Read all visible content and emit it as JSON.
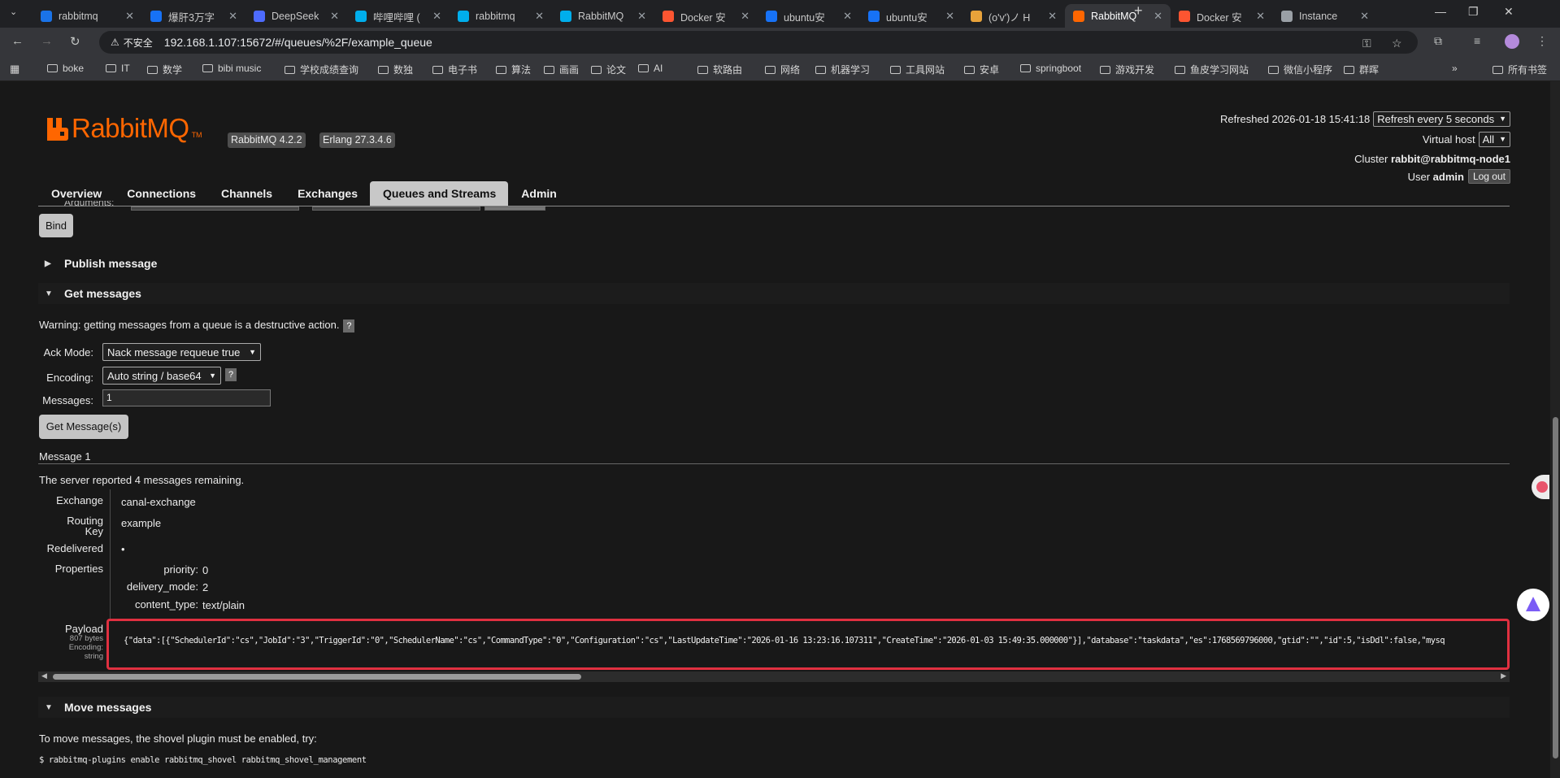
{
  "browser": {
    "tabs": [
      {
        "title": "rabbitmq",
        "icon": "search-icon",
        "color": "#1a73e8"
      },
      {
        "title": "爆肝3万字",
        "icon": "zhihu-icon",
        "color": "#1772f6"
      },
      {
        "title": "DeepSeek",
        "icon": "deepseek-icon",
        "color": "#4d6bfe"
      },
      {
        "title": "哔哩哔哩 (",
        "icon": "bilibili-icon",
        "color": "#00aeec"
      },
      {
        "title": "rabbitmq",
        "icon": "bilibili-icon",
        "color": "#00aeec"
      },
      {
        "title": "RabbitMQ",
        "icon": "bilibili-icon",
        "color": "#00aeec"
      },
      {
        "title": "Docker 安",
        "icon": "csdn-icon",
        "color": "#fc5531"
      },
      {
        "title": "ubuntu安",
        "icon": "zhihu-icon",
        "color": "#1772f6"
      },
      {
        "title": "ubuntu安",
        "icon": "zhihu-icon",
        "color": "#1772f6"
      },
      {
        "title": "(o'v')ノ H",
        "icon": "pinwheel-icon",
        "color": "#e8a23a"
      },
      {
        "title": "RabbitMQ",
        "icon": "rabbitmq-icon",
        "color": "#ff6600"
      },
      {
        "title": "Docker 安",
        "icon": "csdn-icon",
        "color": "#fc5531"
      },
      {
        "title": "Instance",
        "icon": "globe-icon",
        "color": "#9aa0a6"
      }
    ],
    "active_tab_index": 10,
    "security_label": "不安全",
    "url": "192.168.1.107:15672/#/queues/%2F/example_queue",
    "bookmarks": [
      "boke",
      "IT",
      "数学",
      "bibi music",
      "学校成绩查询",
      "数独",
      "电子书",
      "算法",
      "画画",
      "论文",
      "AI",
      "软路由",
      "网络",
      "机器学习",
      "工具网站",
      "安卓",
      "springboot",
      "游戏开发",
      "鱼皮学习网站",
      "微信小程序",
      "群晖"
    ],
    "all_bookmarks": "所有书签"
  },
  "header": {
    "brand": "RabbitMQ",
    "tm": "TM",
    "rabbitmq_version": "RabbitMQ 4.2.2",
    "erlang_version": "Erlang 27.3.4.6",
    "refreshed": "Refreshed 2026-01-18 15:41:18",
    "refresh_option": "Refresh every 5 seconds",
    "virtual_host_label": "Virtual host",
    "virtual_host_value": "All",
    "cluster_label": "Cluster",
    "cluster_value": "rabbit@rabbitmq-node1",
    "user_label": "User",
    "user_value": "admin",
    "logout": "Log out",
    "accent_color": "#ff6600"
  },
  "nav": [
    "Overview",
    "Connections",
    "Channels",
    "Exchanges",
    "Queues and Streams",
    "Admin"
  ],
  "active_nav": "Queues and Streams",
  "bind_section": {
    "arguments_label": "Arguments:",
    "bind_button": "Bind"
  },
  "publish_section": {
    "title": "Publish message"
  },
  "get_section": {
    "title": "Get messages",
    "warning": "Warning: getting messages from a queue is a destructive action.",
    "help": "?",
    "ack_mode_label": "Ack Mode:",
    "ack_mode_value": "Nack message requeue true",
    "encoding_label": "Encoding:",
    "encoding_value": "Auto string / base64",
    "messages_label": "Messages:",
    "messages_value": "1",
    "get_button": "Get Message(s)"
  },
  "message": {
    "heading": "Message 1",
    "remaining": "The server reported 4 messages remaining.",
    "exchange_label": "Exchange",
    "exchange_value": "canal-exchange",
    "routing_key_label_1": "Routing",
    "routing_key_label_2": "Key",
    "routing_key_value": "example",
    "redelivered_label": "Redelivered",
    "redelivered_value": "•",
    "properties_label": "Properties",
    "properties": [
      {
        "key": "priority:",
        "value": "0"
      },
      {
        "key": "delivery_mode:",
        "value": "2"
      },
      {
        "key": "content_type:",
        "value": "text/plain"
      }
    ],
    "payload_label": "Payload",
    "payload_size": "807 bytes",
    "payload_encoding_label": "Encoding:",
    "payload_encoding_value": "string",
    "payload_text": "{\"data\":[{\"SchedulerId\":\"cs\",\"JobId\":\"3\",\"TriggerId\":\"0\",\"SchedulerName\":\"cs\",\"CommandType\":\"0\",\"Configuration\":\"cs\",\"LastUpdateTime\":\"2026-01-16 13:23:16.107311\",\"CreateTime\":\"2026-01-03 15:49:35.000000\"}],\"database\":\"taskdata\",\"es\":1768569796000,\"gtid\":\"\",\"id\":5,\"isDdl\":false,\"mysq",
    "highlight_color": "#e03040"
  },
  "move_section": {
    "title": "Move messages",
    "text": "To move messages, the shovel plugin must be enabled, try:",
    "command": "$ rabbitmq-plugins enable rabbitmq_shovel rabbitmq_shovel_management"
  }
}
